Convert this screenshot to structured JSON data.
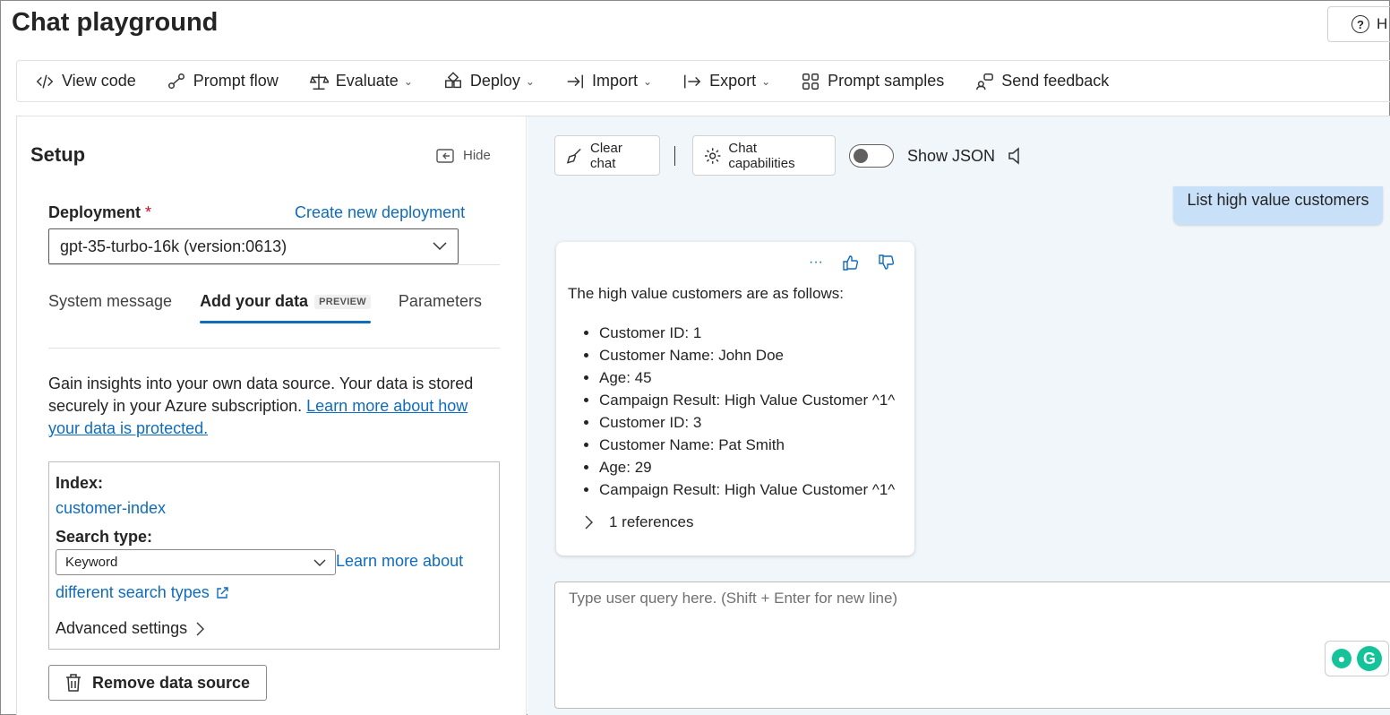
{
  "page": {
    "title": "Chat playground",
    "help_label": "H"
  },
  "toolbar": {
    "view_code": "View code",
    "prompt_flow": "Prompt flow",
    "evaluate": "Evaluate",
    "deploy": "Deploy",
    "import": "Import",
    "export": "Export",
    "prompt_samples": "Prompt samples",
    "send_feedback": "Send feedback"
  },
  "setup": {
    "title": "Setup",
    "hide_label": "Hide",
    "deployment_label": "Deployment",
    "required_mark": "*",
    "create_link": "Create new deployment",
    "deployment_value": "gpt-35-turbo-16k (version:0613)",
    "tabs": [
      {
        "label": "System message"
      },
      {
        "label": "Add your data",
        "badge": "PREVIEW"
      },
      {
        "label": "Parameters"
      }
    ],
    "description": "Gain insights into your own data source. Your data is stored securely in your Azure subscription.",
    "protect_link": "Learn more about how your data is protected.",
    "index_label": "Index:",
    "index_value": "customer-index",
    "search_type_label": "Search type:",
    "search_type_value": "Keyword",
    "learn_more_1": "Learn more about",
    "learn_more_2": "different search types",
    "advanced_settings": "Advanced settings",
    "remove_button": "Remove data source"
  },
  "chat": {
    "clear_chat": "Clear chat",
    "capabilities": "Chat capabilities",
    "show_json": "Show JSON",
    "show_json_on": false,
    "user_message": "List high value customers",
    "reply_intro": "The high value customers are as follows:",
    "reply_items": [
      "Customer ID: 1",
      "Customer Name: John Doe",
      "Age: 45",
      "Campaign Result: High Value Customer ^1^",
      "Customer ID: 3",
      "Customer Name: Pat Smith",
      "Age: 29",
      "Campaign Result: High Value Customer ^1^"
    ],
    "more_actions": "···",
    "references": "1 references",
    "input_placeholder": "Type user query here. (Shift + Enter for new line)"
  },
  "colors": {
    "accent": "#0f6cbd",
    "user_bubble": "#c8e1f8",
    "chat_bg": "#f1f6fb",
    "grammarly": "#15c39a"
  }
}
